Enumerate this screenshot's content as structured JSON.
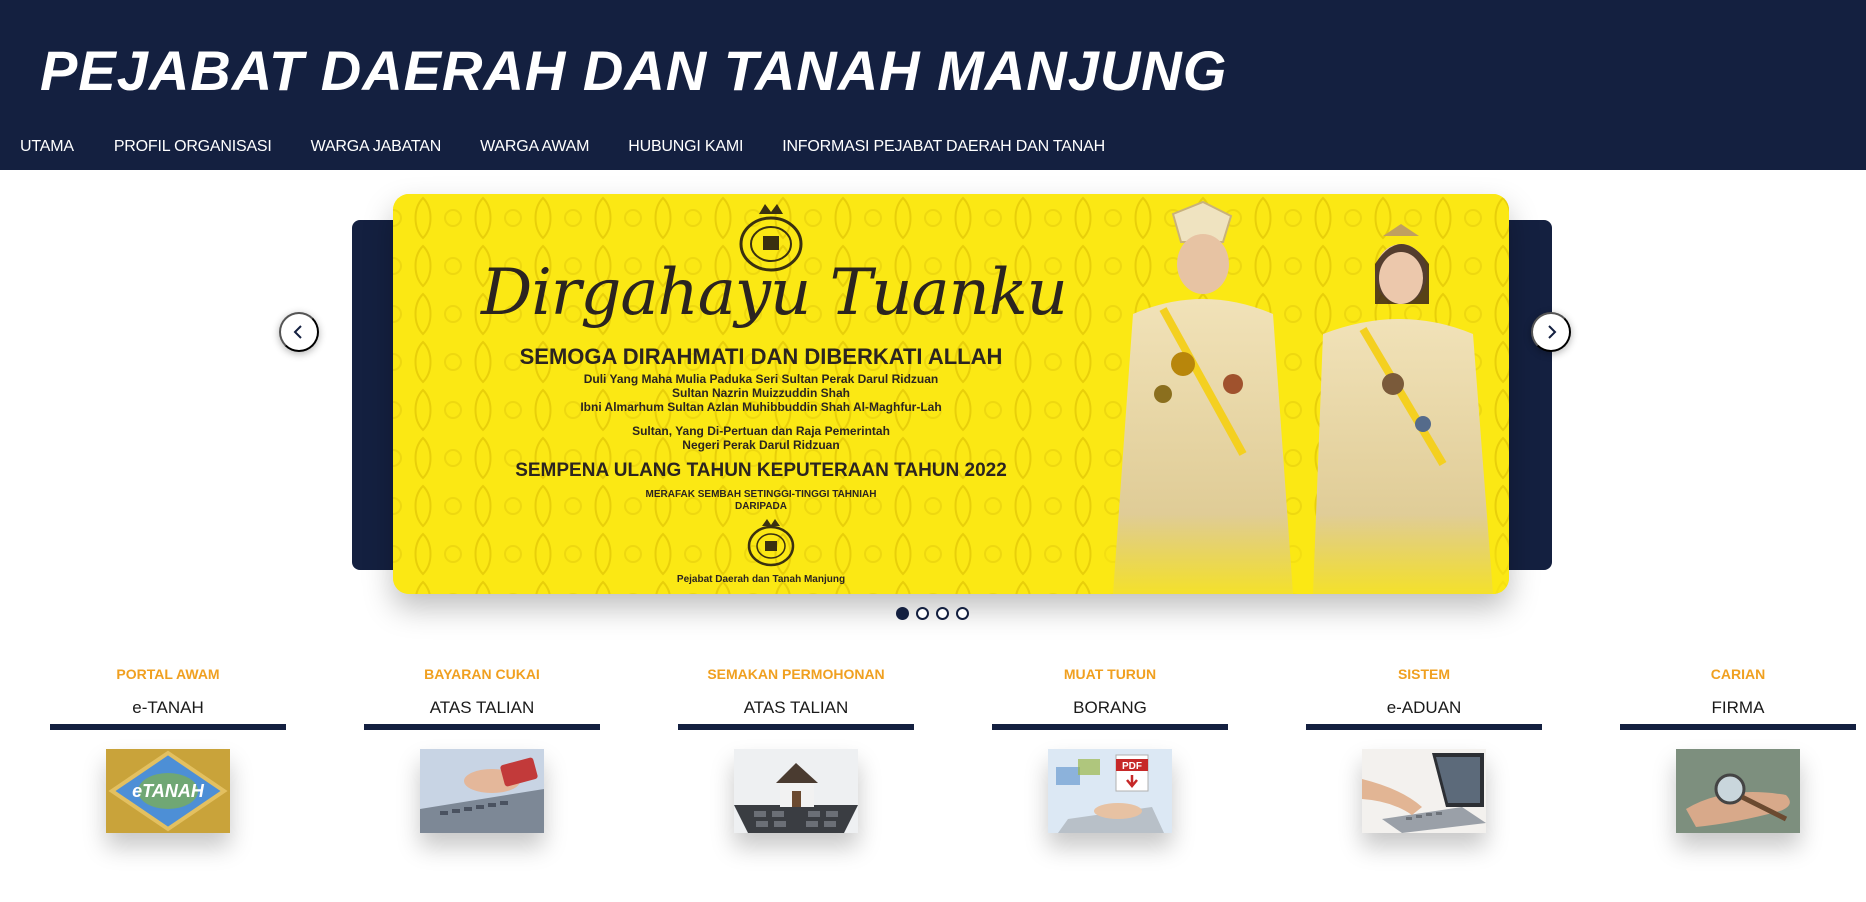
{
  "header": {
    "title": "PEJABAT DAERAH DAN TANAH MANJUNG",
    "background": "#142040"
  },
  "nav": [
    {
      "label": "UTAMA"
    },
    {
      "label": "PROFIL ORGANISASI"
    },
    {
      "label": "WARGA JABATAN"
    },
    {
      "label": "WARGA AWAM"
    },
    {
      "label": "HUBUNGI KAMI"
    },
    {
      "label": "INFORMASI PEJABAT DAERAH DAN TANAH"
    }
  ],
  "carousel": {
    "slide": {
      "script_title": "Dirgahayu Tuanku",
      "headline": "SEMOGA DIRAHMATI DAN DIBERKATI ALLAH",
      "lines": [
        "Duli Yang Maha Mulia Paduka Seri Sultan Perak Darul Ridzuan",
        "Sultan Nazrin Muizzuddin Shah",
        "Ibni Almarhum Sultan Azlan Muhibbuddin Shah Al-Maghfur-Lah",
        "Sultan, Yang Di-Pertuan dan Raja Pemerintah",
        "Negeri Perak Darul Ridzuan"
      ],
      "occasion": "SEMPENA ULANG TAHUN KEPUTERAAN TAHUN 2022",
      "greeting": "MERAFAK SEMBAH SETINGGI-TINGGI TAHNIAH",
      "from": "DARIPADA",
      "sender": "Pejabat Daerah dan Tanah Manjung",
      "background": "#fbe814"
    },
    "slide_count": 4,
    "active_index": 0,
    "prev_icon": "chevron-left-icon",
    "next_icon": "chevron-right-icon"
  },
  "services": [
    {
      "category": "PORTAL AWAM",
      "name": "e-TANAH",
      "image": "etanah-logo-image"
    },
    {
      "category": "BAYARAN CUKAI",
      "name": "ATAS TALIAN",
      "image": "credit-card-laptop-image"
    },
    {
      "category": "SEMAKAN PERMOHONAN",
      "name": "ATAS TALIAN",
      "image": "house-calculator-image"
    },
    {
      "category": "MUAT TURUN",
      "name": "BORANG",
      "image": "pdf-download-image"
    },
    {
      "category": "SISTEM",
      "name": "e-ADUAN",
      "image": "typing-laptop-image"
    },
    {
      "category": "CARIAN",
      "name": "FIRMA",
      "image": "magnifier-hand-image"
    }
  ],
  "colors": {
    "navy": "#142040",
    "accent_orange": "#f0a020",
    "banner_yellow": "#fbe814"
  }
}
